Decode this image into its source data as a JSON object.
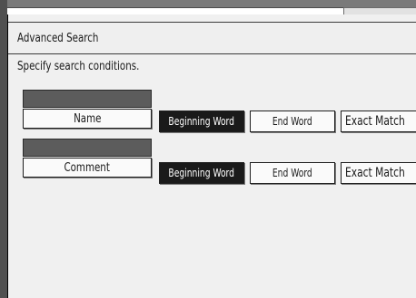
{
  "window": {
    "title": "Advanced Search"
  },
  "instruction": "Specify search conditions.",
  "conditions": [
    {
      "field_value": "",
      "field_label": "Name",
      "options": [
        "Beginning Word",
        "End Word",
        "Exact Match"
      ],
      "selected": "Beginning Word"
    },
    {
      "field_value": "",
      "field_label": "Comment",
      "options": [
        "Beginning Word",
        "End Word",
        "Exact Match"
      ],
      "selected": "Beginning Word"
    }
  ],
  "colors": {
    "selected_bg": "#1a1a1a",
    "selected_text": "#ffffff",
    "field_value_bg": "#5c5c5c",
    "screen_bg": "#f0f0f0"
  }
}
